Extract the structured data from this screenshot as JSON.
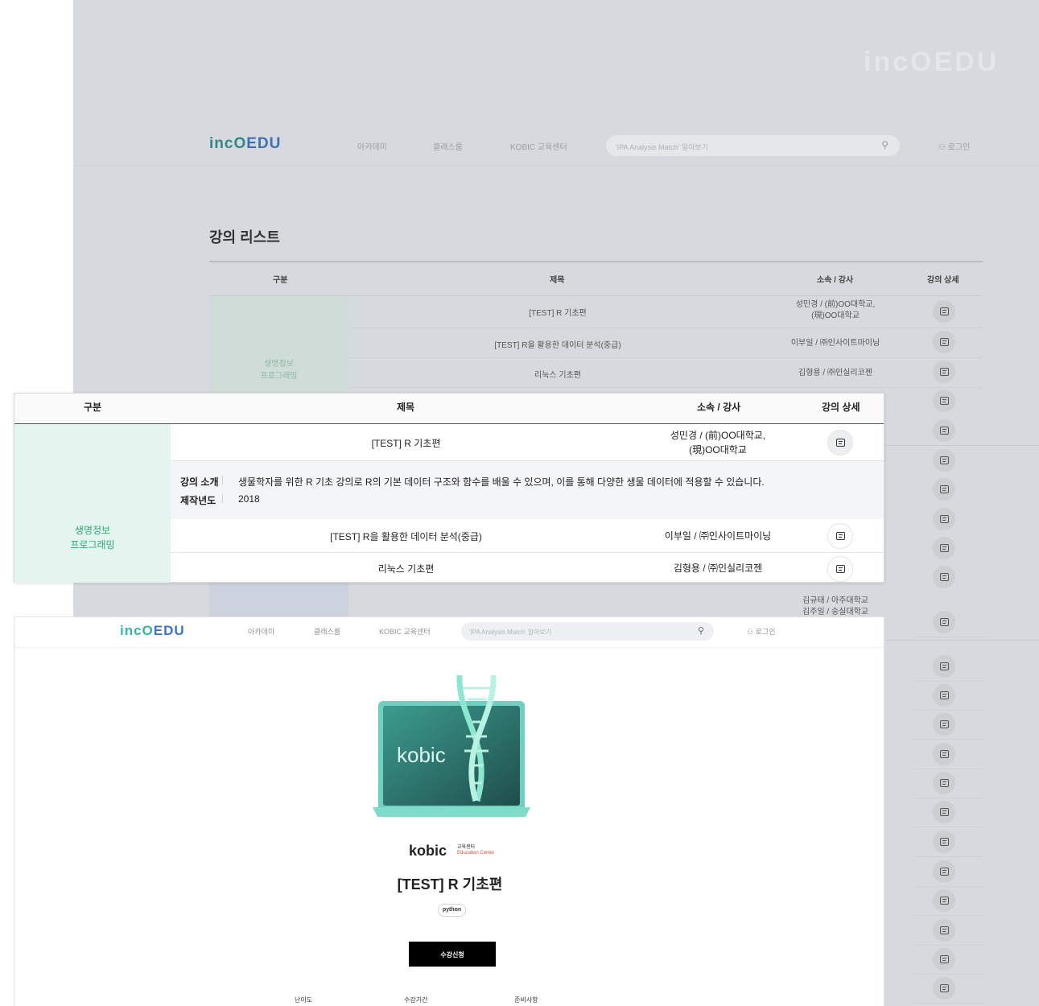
{
  "brand": {
    "logo_inc": "incO",
    "logo_edu": "EDU",
    "watermark": "incOEDU"
  },
  "nav": {
    "items": [
      "아카데미",
      "클래스룸",
      "KOBIC 교육센터"
    ],
    "search_placeholder": "'IPA Analysis Match' 알아보기",
    "login": "로그인"
  },
  "list_page": {
    "title": "강의 리스트",
    "columns": [
      "구분",
      "제목",
      "소속 / 강사",
      "강의 상세"
    ],
    "category": "생명정보\n프로그래밍",
    "rows": [
      {
        "title": "[TEST] R 기초편",
        "instructor": "성민경 / (前)OO대학교,\n(現)OO대학교"
      },
      {
        "title": "[TEST] R을 활용한 데이터 분석(중급)",
        "instructor": "이부일 / ㈜인사이트마이닝"
      },
      {
        "title": "리눅스 기초편",
        "instructor": "김형용 / ㈜인실리코젠"
      }
    ],
    "extra_instructor": "김규태 / 아주대학교\n김주일 / 숭실대학교"
  },
  "expanded_table": {
    "columns": [
      "구분",
      "제목",
      "소속 / 강사",
      "강의 상세"
    ],
    "category": "생명정보\n프로그래밍",
    "rows": [
      {
        "title": "[TEST] R 기초편",
        "instructor": "성민경 / (前)OO대학교,\n(現)OO대학교"
      },
      {
        "title": "[TEST] R을 활용한 데이터 분석(중급)",
        "instructor": "이부일 / ㈜인사이트마이닝"
      },
      {
        "title": "리눅스 기초편",
        "instructor": "김형용 / ㈜인실리코젠"
      }
    ],
    "detail": {
      "intro_label": "강의 소개",
      "intro_text": "생물학자를 위한 R 기초 강의로 R의 기본 데이터 구조와 함수를 배울 수 있으며, 이를 통해 다양한 생물 데이터에 적용할 수 있습니다.",
      "year_label": "제작년도",
      "year": "2018"
    }
  },
  "course_detail": {
    "illus_text": "kobic",
    "brand_name": "kobic",
    "brand_sub_ko": "교육센터",
    "brand_sub_en_a": "Education",
    "brand_sub_en_b": "Center",
    "title": "[TEST] R 기초편",
    "tag": "python",
    "enroll_label": "수강신청",
    "info_labels": [
      "난이도",
      "수강기간",
      "준비사항"
    ]
  },
  "colors": {
    "accent_green": "#2ea873",
    "logo_teal": "#35b3a4",
    "logo_blue": "#3a74c9",
    "button_black": "#000000"
  },
  "icons": {
    "search": "search-icon",
    "user": "user-icon",
    "detail": "document-icon"
  }
}
